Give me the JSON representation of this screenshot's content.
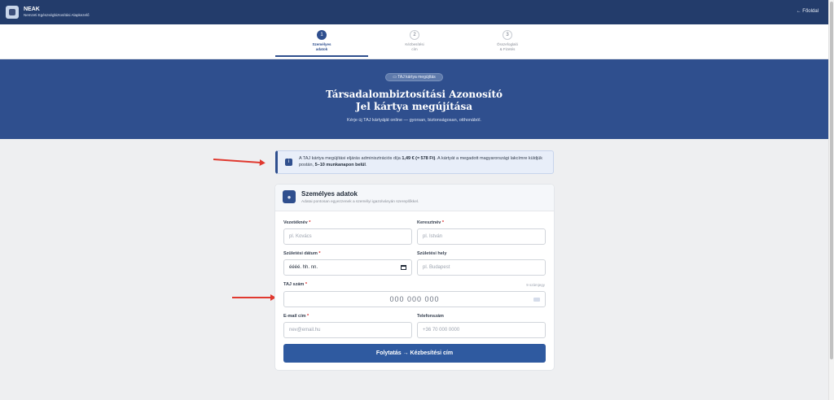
{
  "header": {
    "brand_name": "NEAK",
    "brand_subtitle": "Nemzeti Egészségbiztosítási Alapkezelő",
    "home_link": "← Főoldal"
  },
  "steps": [
    {
      "num": "1",
      "label": "Személyes\nadatok",
      "active": true
    },
    {
      "num": "2",
      "label": "Kézbesítési\ncím",
      "active": false
    },
    {
      "num": "3",
      "label": "Összefoglaló\n& Fizetés",
      "active": false
    }
  ],
  "hero": {
    "badge": "TAJ kártya megújítás",
    "title_line1": "Társadalombiztosítási Azonosító",
    "title_line2": "Jel kártya megújítása",
    "subtitle": "Kérje új TAJ kártyáját online — gyorsan, biztonságosan, otthonából."
  },
  "info": {
    "text1": "A TAJ kártya megújítási eljárás adminisztrációs díja ",
    "fee": "1,49 € (≈ 578 Ft)",
    "text2": ". A kártyát a megadott magyarországi lakcímre küldjük postán, ",
    "deadline": "5–10 munkanapon belül",
    "text3": "."
  },
  "card": {
    "title": "Személyes adatok",
    "subtitle": "Adatai pontosan egyezzenek a személyi igazolványán szereplőkkel."
  },
  "form": {
    "last_name_label": "Vezetéknév",
    "last_name_placeholder": "pl. Kovács",
    "first_name_label": "Keresztnév",
    "first_name_placeholder": "pl. István",
    "birth_date_label": "Születési dátum",
    "birth_date_value": "éééé. hh. nn.",
    "birth_place_label": "Születési hely",
    "birth_place_placeholder": "pl. Budapest",
    "taj_label": "TAJ szám",
    "taj_hint": "9 számjegy",
    "taj_placeholder": "000 000 000",
    "email_label": "E-mail cím",
    "email_placeholder": "nev@email.hu",
    "phone_label": "Telefonszám",
    "phone_placeholder": "+36 70 000 0000",
    "required_mark": "*",
    "submit_label": "Folytatás → Kézbesítési cím"
  }
}
